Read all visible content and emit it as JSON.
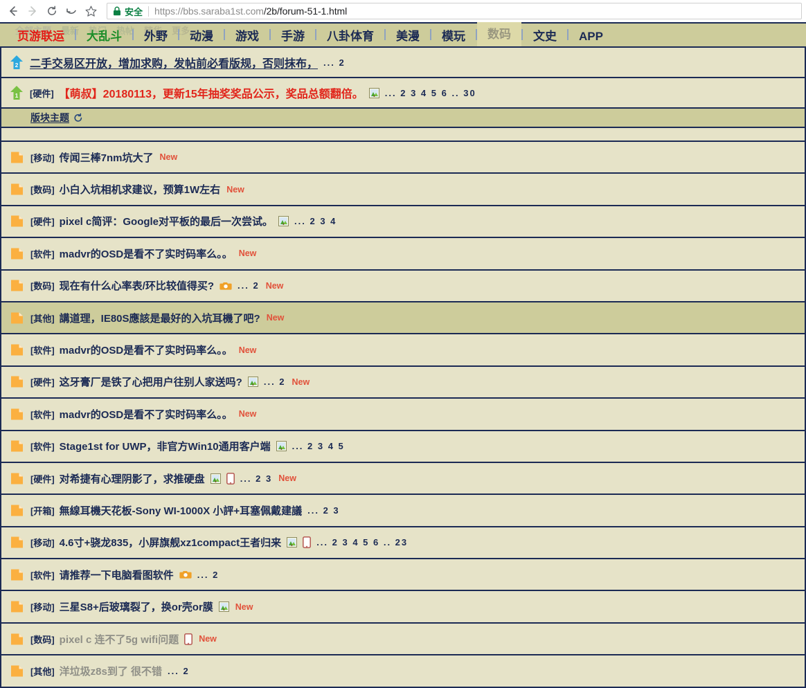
{
  "browser": {
    "back_icon": "back-arrow-icon",
    "forward_icon": "forward-arrow-icon",
    "reload_icon": "reload-icon",
    "home_icon": "undo-arrow-icon",
    "bookmark_icon": "star-icon",
    "lock_icon": "lock-icon",
    "secure_label": "安全",
    "url_scheme_host": "https://bbs.saraba1st.com",
    "url_path": "/2b/forum-51-1.html",
    "url_full": "https://bbs.saraba1st.com/2b/forum-51-1.html"
  },
  "forum": {
    "ghost_nav": [
      "全部主题",
      "最新",
      "热门",
      "热帖",
      "精华",
      "更多"
    ],
    "tabs": [
      {
        "label": "页游联运",
        "style": "red",
        "active": false
      },
      {
        "label": "大乱斗",
        "style": "green",
        "active": false
      },
      {
        "label": "外野",
        "style": "normal",
        "active": false
      },
      {
        "label": "动漫",
        "style": "normal",
        "active": false
      },
      {
        "label": "游戏",
        "style": "normal",
        "active": false
      },
      {
        "label": "手游",
        "style": "normal",
        "active": false
      },
      {
        "label": "八卦体育",
        "style": "normal",
        "active": false
      },
      {
        "label": "美漫",
        "style": "normal",
        "active": false
      },
      {
        "label": "模玩",
        "style": "normal",
        "active": false
      },
      {
        "label": "数码",
        "style": "normal",
        "active": true
      },
      {
        "label": "文史",
        "style": "normal",
        "active": false
      },
      {
        "label": "APP",
        "style": "normal",
        "active": false
      }
    ],
    "sticky": [
      {
        "level_icon": "sticky-arrow-blue-2-icon",
        "level": "2",
        "category": "",
        "title": "二手交易区开放，增加求购，发帖前必看版规，否则抹布，",
        "title_color": "blue",
        "icons": [],
        "pages": "... 2"
      },
      {
        "level_icon": "sticky-arrow-green-1-icon",
        "level": "1",
        "category": "[硬件]",
        "title": "【萌叔】20180113，更新15年抽奖奖品公示，奖品总额翻倍。",
        "title_color": "red",
        "icons": [
          "attachment-image-icon"
        ],
        "pages": "... 2 3 4 5 6 .. 30"
      }
    ],
    "section_header": {
      "label": "版块主题",
      "refresh_icon": "refresh-icon"
    },
    "threads": [
      {
        "category": "[移动]",
        "title": "传闻三棒7nm坑大了",
        "visited": false,
        "icons": [],
        "pages": "",
        "new": "New",
        "highlight": false
      },
      {
        "category": "[数码]",
        "title": "小白入坑相机求建议，预算1W左右",
        "visited": false,
        "icons": [],
        "pages": "",
        "new": "New",
        "highlight": false
      },
      {
        "category": "[硬件]",
        "title": "pixel c简评：Google对平板的最后一次尝试。",
        "visited": false,
        "icons": [
          "attachment-image-icon"
        ],
        "pages": "... 2 3 4",
        "new": "",
        "highlight": false
      },
      {
        "category": "[软件]",
        "title": "madvr的OSD是看不了实时码率么。。",
        "visited": false,
        "icons": [],
        "pages": "",
        "new": "New",
        "highlight": false
      },
      {
        "category": "[数码]",
        "title": "现在有什么心率表/环比较值得买?",
        "visited": false,
        "icons": [
          "camera-icon"
        ],
        "pages": "... 2",
        "new": "New",
        "highlight": false
      },
      {
        "category": "[其他]",
        "title": "講道理，IE80S應該是最好的入坑耳機了吧?",
        "visited": false,
        "icons": [],
        "pages": "",
        "new": "New",
        "highlight": true
      },
      {
        "category": "[软件]",
        "title": "madvr的OSD是看不了实时码率么。。",
        "visited": false,
        "icons": [],
        "pages": "",
        "new": "New",
        "highlight": false
      },
      {
        "category": "[硬件]",
        "title": "这牙膏厂是铁了心把用户往别人家送吗?",
        "visited": false,
        "icons": [
          "attachment-image-icon"
        ],
        "pages": "... 2",
        "new": "New",
        "highlight": false
      },
      {
        "category": "[软件]",
        "title": "madvr的OSD是看不了实时码率么。。",
        "visited": false,
        "icons": [],
        "pages": "",
        "new": "New",
        "highlight": false
      },
      {
        "category": "[软件]",
        "title": "Stage1st for UWP，非官方Win10通用客户端",
        "visited": false,
        "icons": [
          "attachment-image-icon"
        ],
        "pages": "... 2 3 4 5",
        "new": "",
        "highlight": false
      },
      {
        "category": "[硬件]",
        "title": "对希捷有心理阴影了，求推硬盘",
        "visited": false,
        "icons": [
          "attachment-image-icon",
          "mobile-icon"
        ],
        "pages": "... 2 3",
        "new": "New",
        "highlight": false
      },
      {
        "category": "[开箱]",
        "title": "無線耳機天花板-Sony WI-1000X 小評+耳塞佩戴建議",
        "visited": false,
        "icons": [],
        "pages": "... 2 3",
        "new": "",
        "highlight": false
      },
      {
        "category": "[移动]",
        "title": "4.6寸+骁龙835，小屏旗舰xz1compact王者归来",
        "visited": false,
        "icons": [
          "attachment-image-icon",
          "mobile-icon"
        ],
        "pages": "... 2 3 4 5 6 .. 23",
        "new": "",
        "highlight": false
      },
      {
        "category": "[软件]",
        "title": "请推荐一下电脑看图软件",
        "visited": false,
        "icons": [
          "camera-icon"
        ],
        "pages": "... 2",
        "new": "",
        "highlight": false
      },
      {
        "category": "[移动]",
        "title": "三星S8+后玻璃裂了，换or壳or膜",
        "visited": false,
        "icons": [
          "attachment-image-icon"
        ],
        "pages": "",
        "new": "New",
        "highlight": false
      },
      {
        "category": "[数码]",
        "title": "pixel c 连不了5g wifi问题",
        "visited": true,
        "icons": [
          "mobile-icon"
        ],
        "pages": "",
        "new": "New",
        "highlight": false
      },
      {
        "category": "[其他]",
        "title": "洋垃圾z8s到了 很不错",
        "visited": true,
        "icons": [],
        "pages": "... 2",
        "new": "",
        "highlight": false
      }
    ]
  },
  "colors": {
    "page_bg": "#e6e3c8",
    "band_bg": "#cdcc9b",
    "border": "#1b2a54",
    "link": "#1b2a54",
    "new_badge": "#e1513a",
    "red_tab": "#e41b16",
    "green_tab": "#1a8d28",
    "visited": "#8f8f87",
    "secure_green": "#0b8043"
  }
}
